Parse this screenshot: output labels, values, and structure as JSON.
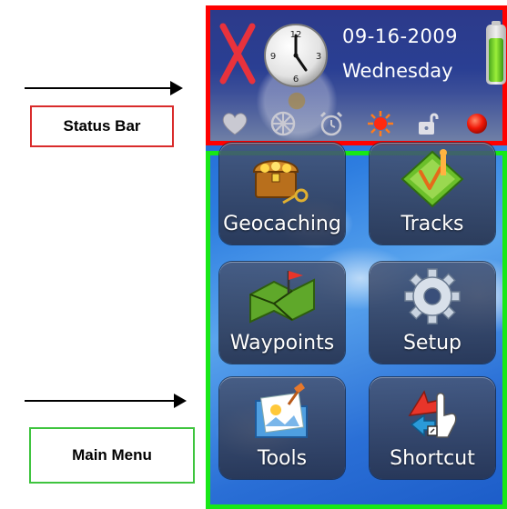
{
  "annotations": {
    "status_bar_label": "Status Bar",
    "main_menu_label": "Main Menu"
  },
  "status_bar": {
    "date": "09-16-2009",
    "day": "Wednesday",
    "battery_level": 0.8,
    "icons": [
      "heart-icon",
      "wheel-icon",
      "alarm-clock-icon",
      "sun-icon",
      "unlocked-padlock-icon",
      "record-dot-icon"
    ]
  },
  "main_menu": {
    "items": [
      {
        "label": "Geocaching",
        "icon": "treasure-chest-icon"
      },
      {
        "label": "Tracks",
        "icon": "tracks-icon"
      },
      {
        "label": "Waypoints",
        "icon": "map-flag-icon"
      },
      {
        "label": "Setup",
        "icon": "gear-icon"
      },
      {
        "label": "Tools",
        "icon": "tools-folder-icon"
      },
      {
        "label": "Shortcut",
        "icon": "shortcut-arrows-icon"
      }
    ]
  },
  "colors": {
    "status_bar_border": "#ff0000",
    "main_menu_border": "#17e817",
    "status_callout_border": "#d92b2b",
    "menu_callout_border": "#3ec43e"
  }
}
